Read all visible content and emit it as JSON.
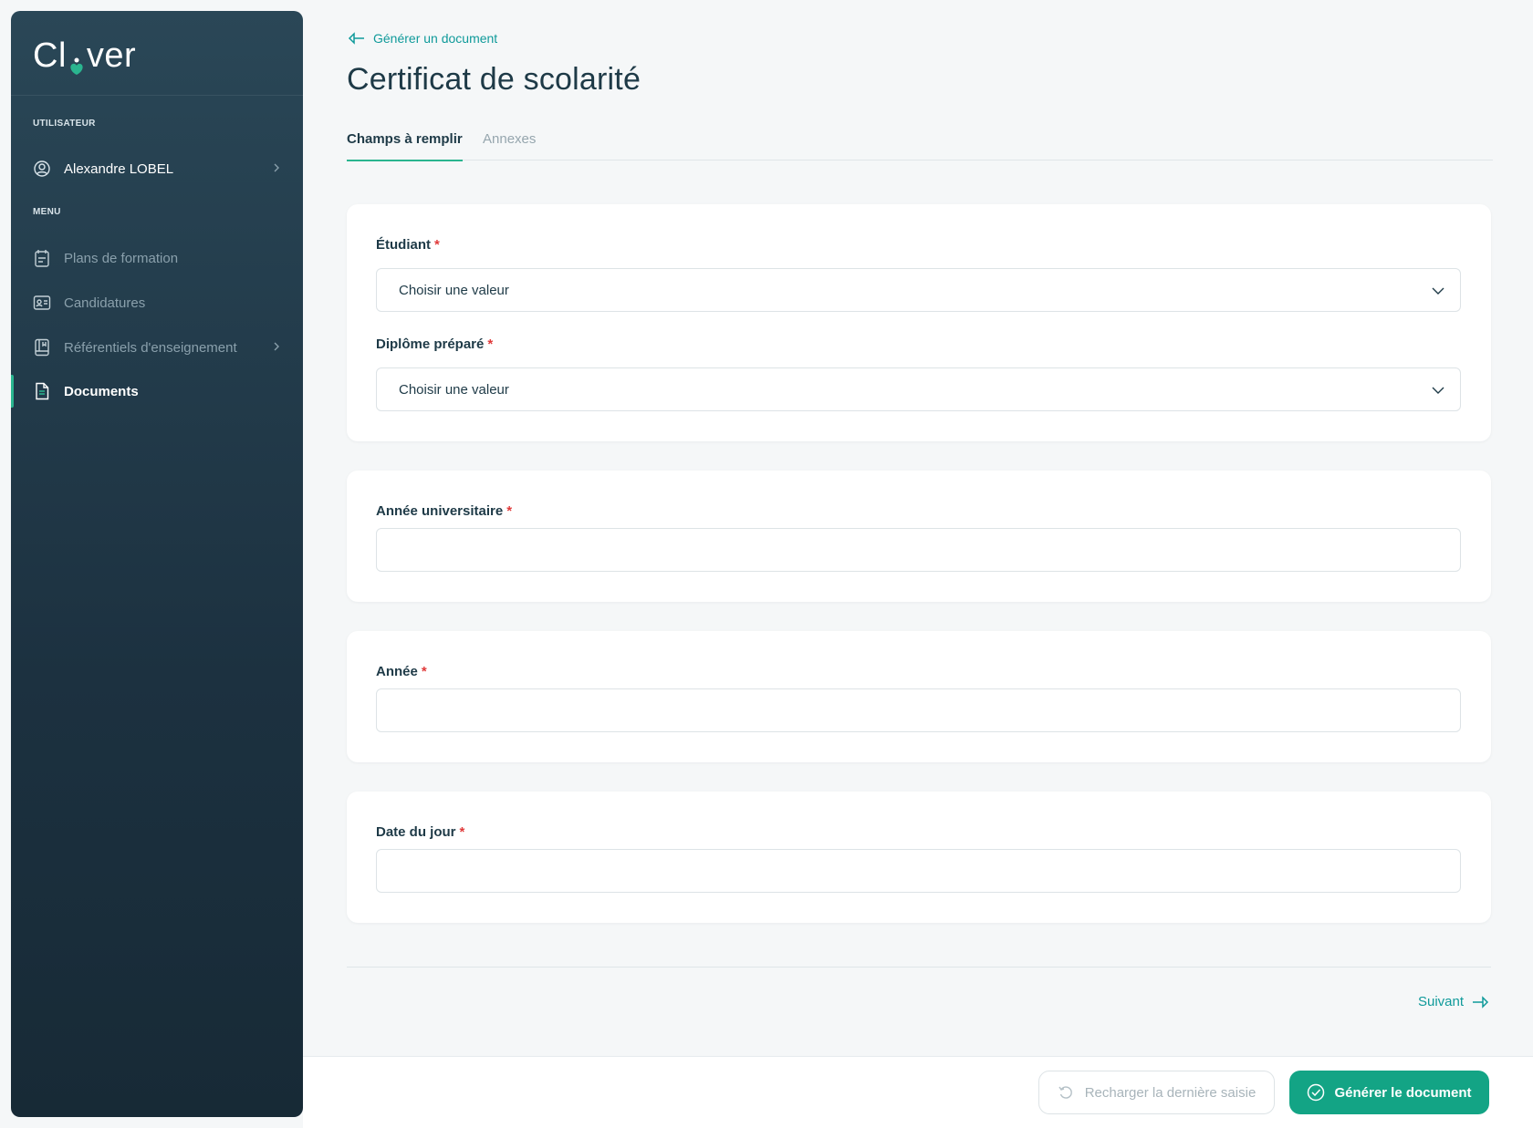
{
  "brand": {
    "logo_left": "Cl",
    "logo_right": "ver",
    "accent": "#2ab58f",
    "primary": "#13a485",
    "link": "#0f9a9a",
    "required": "#e03a3a"
  },
  "sidebar": {
    "user_section_label": "UTILISATEUR",
    "user_name": "Alexandre LOBEL",
    "menu_section_label": "MENU",
    "items": [
      {
        "label": "Plans de formation",
        "icon": "book-icon"
      },
      {
        "label": "Candidatures",
        "icon": "id-card-icon"
      },
      {
        "label": "Référentiels d'enseignement",
        "icon": "notebook-icon"
      },
      {
        "label": "Documents",
        "icon": "document-icon",
        "active": true
      }
    ]
  },
  "header": {
    "back_label": "Générer un document",
    "title": "Certificat de scolarité"
  },
  "tabs": [
    {
      "label": "Champs à remplir",
      "active": true
    },
    {
      "label": "Annexes",
      "active": false
    }
  ],
  "form": {
    "required_mark": "*",
    "etudiant": {
      "label": "Étudiant",
      "value": "Choisir une valeur"
    },
    "diplome": {
      "label": "Diplôme préparé",
      "value": "Choisir une valeur"
    },
    "annee_universitaire": {
      "label": "Année universitaire",
      "value": ""
    },
    "annee": {
      "label": "Année",
      "value": ""
    },
    "date_du_jour": {
      "label": "Date du jour",
      "value": ""
    }
  },
  "navigation": {
    "next_label": "Suivant"
  },
  "footer": {
    "reload_label": "Recharger la dernière saisie",
    "generate_label": "Générer le document"
  }
}
